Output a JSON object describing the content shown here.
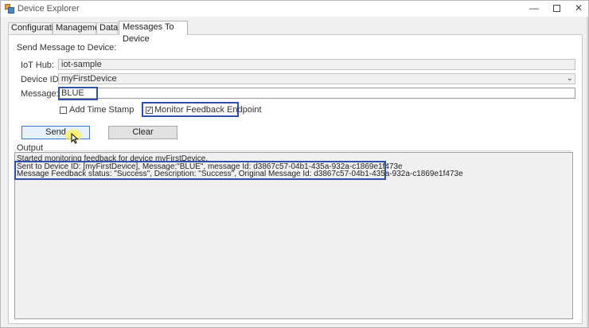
{
  "window": {
    "title": "Device Explorer",
    "minimize_glyph": "—",
    "close_glyph": "✕"
  },
  "tabs": [
    {
      "label": "Configuration",
      "active": false
    },
    {
      "label": "Management",
      "active": false
    },
    {
      "label": "Data",
      "active": false
    },
    {
      "label": "Messages To Device",
      "active": true
    }
  ],
  "form": {
    "section_title": "Send Message to Device:",
    "iot_hub_label": "IoT Hub:",
    "iot_hub_value": "iot-sample",
    "device_id_label": "Device ID:",
    "device_id_value": "myFirstDevice",
    "message_label": "Message:",
    "message_value": "BLUE",
    "add_timestamp_label": "Add Time Stamp",
    "add_timestamp_checked": false,
    "monitor_feedback_label": "Monitor Feedback Endpoint",
    "monitor_feedback_checked": true,
    "send_label": "Send",
    "clear_label": "Clear"
  },
  "output": {
    "group_label": "Output",
    "lines": [
      "Started monitoring feedback for device myFirstDevice.",
      "Sent to Device ID: [myFirstDevice], Message:\"BLUE\", message Id: d3867c57-04b1-435a-932a-c1869e1f473e",
      "Message Feedback status: \"Success\", Description: \"Success\", Original Message Id: d3867c57-04b1-435a-932a-c1869e1f473e"
    ]
  },
  "colors": {
    "highlight": "#2f4fa8",
    "cursor_glow": "#fff03c",
    "primary_button_border": "#3c78c8"
  },
  "icons": {
    "app": "device-explorer-icon",
    "dropdown": "chevron-down-icon",
    "check": "checkmark-icon",
    "cursor": "mouse-pointer-icon"
  }
}
